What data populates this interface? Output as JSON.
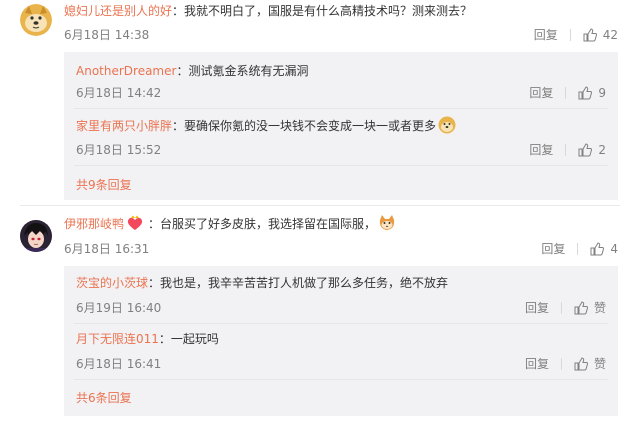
{
  "comments": [
    {
      "user": "媳妇儿还是别人的好",
      "text": "：我就不明白了，国服是有什么高精技术吗？测来测去？",
      "time": "6月18日 14:38",
      "reply": "回复",
      "likes": "42",
      "replies": [
        {
          "user": "AnotherDreamer",
          "text": "：测试氪金系统有无漏洞",
          "time": "6月18日 14:42",
          "reply": "回复",
          "likes": "9"
        },
        {
          "user": "家里有两只小胖胖",
          "text": "：要确保你氪的没一块钱不会变成一块一或者更多",
          "time": "6月18日 15:52",
          "reply": "回复",
          "likes": "2"
        }
      ],
      "more": "共9条回复"
    },
    {
      "user": "伊邪那岐鸭",
      "text": "：台服买了好多皮肤，我选择留在国际服，",
      "time": "6月18日 16:31",
      "reply": "回复",
      "likes": "4",
      "replies": [
        {
          "user": "茨宝的小茨球",
          "text": "：我也是，我辛辛苦苦打人机做了那么多任务，绝不放弃",
          "time": "6月19日 16:40",
          "reply": "回复",
          "likes": "赞"
        },
        {
          "user": "月下无限连011",
          "text": "：一起玩吗",
          "time": "6月18日 16:41",
          "reply": "回复",
          "likes": "赞"
        }
      ],
      "more": "共6条回复"
    }
  ],
  "colors": {
    "username": "#eb7350",
    "meta": "#808080",
    "subbox": "#f2f2f5"
  },
  "icons": [
    "doge-avatar-icon",
    "anime-avatar-icon",
    "thumbs-up-icon",
    "doge-emoji-icon",
    "heart-crown-icon",
    "cat-emoji-icon"
  ]
}
